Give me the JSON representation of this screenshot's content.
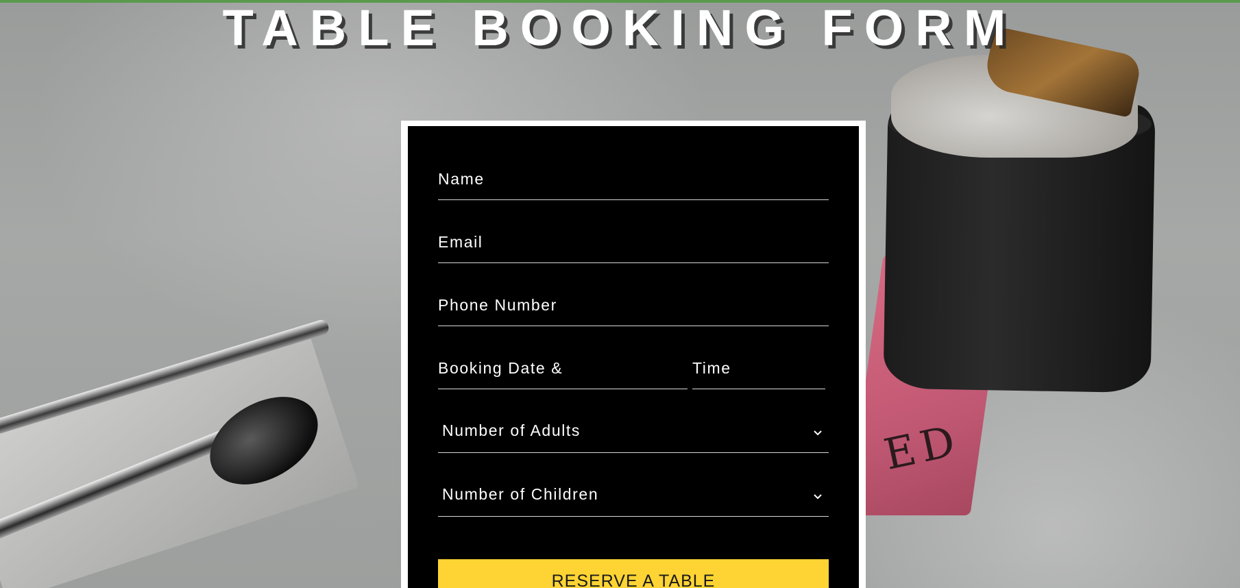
{
  "page": {
    "title": "TABLE BOOKING FORM"
  },
  "form": {
    "name_placeholder": "Name",
    "email_placeholder": "Email",
    "phone_placeholder": "Phone Number",
    "date_placeholder": "Booking Date &",
    "time_placeholder": "Time",
    "adults_select": {
      "selected": "Number of Adults",
      "icon": "chevron-down-icon"
    },
    "children_select": {
      "selected": "Number of Children",
      "icon": "chevron-down-icon"
    },
    "submit_label": "RESERVE A TABLE"
  },
  "background": {
    "sign_text": "ED"
  },
  "colors": {
    "accent": "#fdd433",
    "form_background": "#000000",
    "form_border": "#ffffff",
    "top_line": "#5a9a4d"
  }
}
